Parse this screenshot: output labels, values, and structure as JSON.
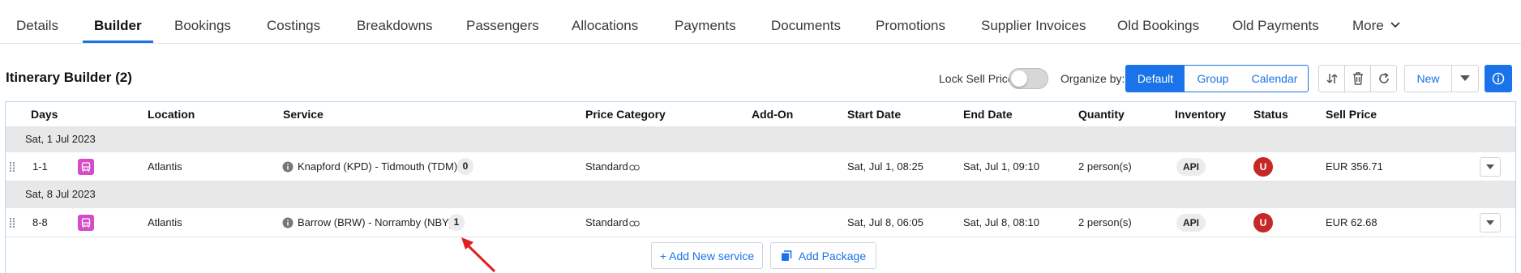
{
  "tabs": [
    {
      "label": "Details"
    },
    {
      "label": "Builder"
    },
    {
      "label": "Bookings"
    },
    {
      "label": "Costings"
    },
    {
      "label": "Breakdowns"
    },
    {
      "label": "Passengers"
    },
    {
      "label": "Allocations"
    },
    {
      "label": "Payments"
    },
    {
      "label": "Documents"
    },
    {
      "label": "Promotions"
    },
    {
      "label": "Supplier Invoices"
    },
    {
      "label": "Old Bookings"
    },
    {
      "label": "Old Payments"
    },
    {
      "label": "More"
    }
  ],
  "active_tab": "Builder",
  "toolbar": {
    "title": "Itinerary Builder (2)",
    "lock_sell_price_label": "Lock Sell Price",
    "lock_sell_price_on": false,
    "organize_by_label": "Organize by:",
    "organize_options": [
      "Default",
      "Group",
      "Calendar"
    ],
    "organize_selected": "Default",
    "new_label": "New"
  },
  "table": {
    "columns": [
      "Days",
      "Location",
      "Service",
      "Price Category",
      "Add-On",
      "Start Date",
      "End Date",
      "Quantity",
      "Inventory",
      "Status",
      "Sell Price"
    ],
    "groups": [
      {
        "date": "Sat, 1 Jul 2023",
        "rows": [
          {
            "days": "1-1",
            "service_type_icon": "bus-icon",
            "location": "Atlantis",
            "service": "Knapford (KPD) - Tidmouth (TDM)",
            "count": "0",
            "price_category": "Standard",
            "add_on": "",
            "start_date": "Sat, Jul 1, 08:25",
            "end_date": "Sat, Jul 1, 09:10",
            "quantity": "2 person(s)",
            "inventory": "API",
            "status": "U",
            "sell_price": "EUR 356.71"
          }
        ]
      },
      {
        "date": "Sat, 8 Jul 2023",
        "rows": [
          {
            "days": "8-8",
            "service_type_icon": "bus-icon",
            "location": "Atlantis",
            "service": "Barrow (BRW) - Norramby (NBY)",
            "count": "1",
            "price_category": "Standard",
            "add_on": "",
            "start_date": "Sat, Jul 8, 06:05",
            "end_date": "Sat, Jul 8, 08:10",
            "quantity": "2 person(s)",
            "inventory": "API",
            "status": "U",
            "sell_price": "EUR 62.68"
          }
        ]
      }
    ]
  },
  "footer": {
    "add_service_label": "+ Add New service",
    "add_package_label": "Add Package"
  },
  "colors": {
    "accent": "#1a73e8",
    "status_unconfirmed": "#c62828",
    "bus_icon_bg": "#d54cc8",
    "annotation_arrow": "#e02020"
  }
}
